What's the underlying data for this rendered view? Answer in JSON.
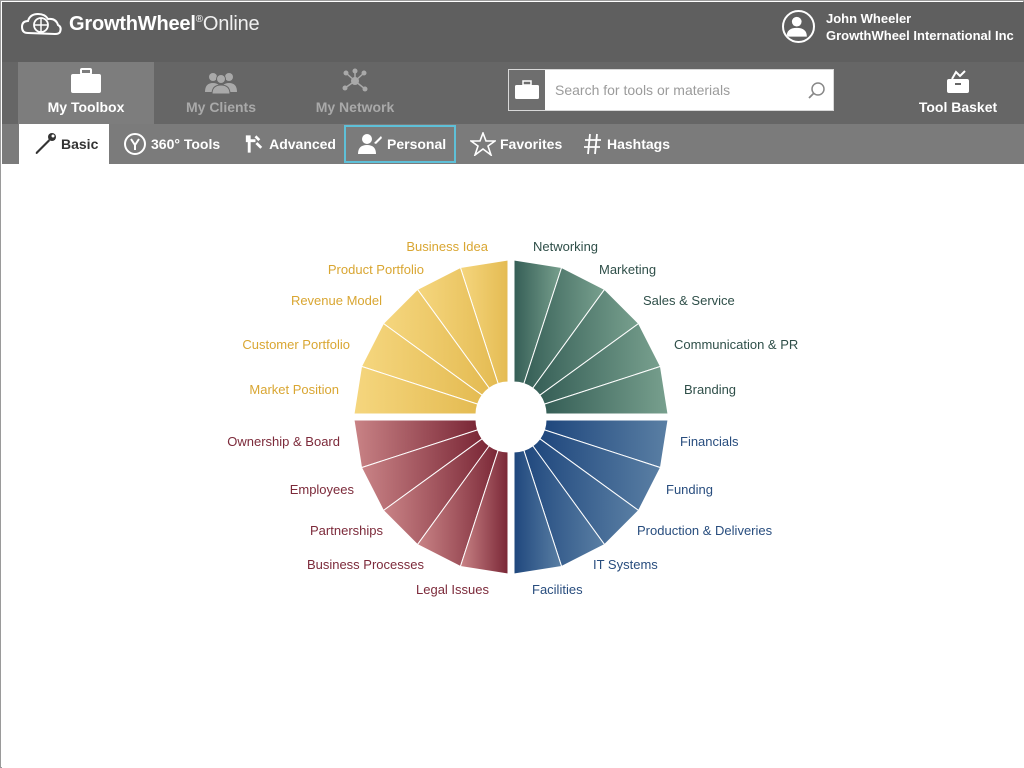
{
  "app": {
    "logo_bold": "GrowthWheel",
    "logo_reg": "®",
    "logo_light": "Online"
  },
  "user": {
    "name": "John Wheeler",
    "company": "GrowthWheel International Inc"
  },
  "nav": {
    "items": [
      {
        "label": "My Toolbox",
        "icon": "briefcase-icon",
        "active": true
      },
      {
        "label": "My Clients",
        "icon": "people-icon",
        "active": false
      },
      {
        "label": "My Network",
        "icon": "network-icon",
        "active": false
      }
    ],
    "tool_basket": "Tool Basket"
  },
  "search": {
    "placeholder": "Search for tools or materials",
    "value": ""
  },
  "tabs": [
    {
      "label": "Basic",
      "icon": "wrench-icon",
      "state": "active"
    },
    {
      "label": "360° Tools",
      "icon": "wheel-icon",
      "state": ""
    },
    {
      "label": "Advanced",
      "icon": "tools-icon",
      "state": ""
    },
    {
      "label": "Personal",
      "icon": "person-icon",
      "state": "focused"
    },
    {
      "label": "Favorites",
      "icon": "star-icon",
      "state": ""
    },
    {
      "label": "Hashtags",
      "icon": "hash-icon",
      "state": ""
    }
  ],
  "wheel": {
    "quadrants": [
      {
        "name": "yellow",
        "color": "#e4bb52",
        "light": "#f5d67e",
        "text": "#d9a632",
        "segments": [
          "Business Idea",
          "Product Portfolio",
          "Revenue Model",
          "Customer Portfolio",
          "Market Position"
        ]
      },
      {
        "name": "green",
        "color": "#355e56",
        "light": "#78a08e",
        "text": "#2f4f49",
        "segments": [
          "Networking",
          "Marketing",
          "Sales & Service",
          "Communication & PR",
          "Branding"
        ]
      },
      {
        "name": "blue",
        "color": "#1f477d",
        "light": "#5a7fa4",
        "text": "#284d7e",
        "segments": [
          "Financials",
          "Funding",
          "Production & Deliveries",
          "IT Systems",
          "Facilities"
        ]
      },
      {
        "name": "red",
        "color": "#7a2736",
        "light": "#c98386",
        "text": "#7c2a3a",
        "segments": [
          "Ownership & Board",
          "Employees",
          "Partnerships",
          "Business Processes",
          "Legal Issues"
        ]
      }
    ]
  }
}
